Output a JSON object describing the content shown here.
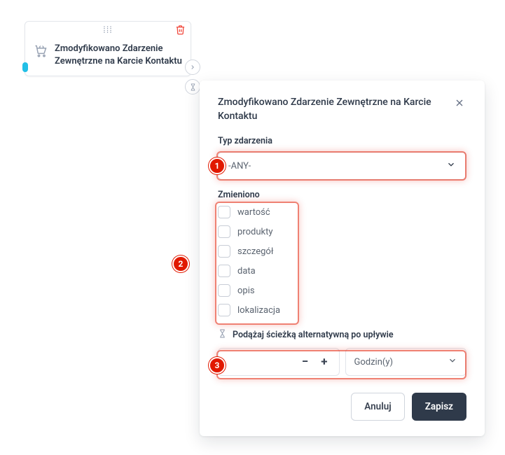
{
  "node": {
    "title": "Zmodyfikowano Zdarzenie Zewnętrzne na Karcie Kontaktu"
  },
  "panel": {
    "title": "Zmodyfikowano Zdarzenie Zewnętrzne na Karcie Kontaktu",
    "event_type": {
      "label": "Typ zdarzenia",
      "value": "-ANY-"
    },
    "changed": {
      "label": "Zmieniono",
      "options": [
        {
          "label": "wartość"
        },
        {
          "label": "produkty"
        },
        {
          "label": "szczegół"
        },
        {
          "label": "data"
        },
        {
          "label": "opis"
        },
        {
          "label": "lokalizacja"
        }
      ]
    },
    "alt_path": {
      "label": "Podążaj ścieżką alternatywną po upływie",
      "unit": "Godzin(y)"
    },
    "buttons": {
      "cancel": "Anuluj",
      "save": "Zapisz"
    }
  },
  "callouts": {
    "b1": "1",
    "b2": "2",
    "b3": "3"
  }
}
